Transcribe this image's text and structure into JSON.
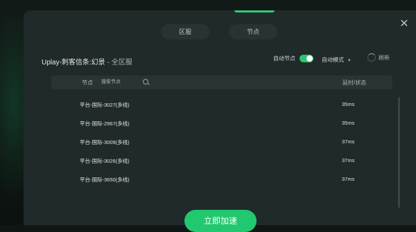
{
  "tabs": [
    {
      "label": "区服"
    },
    {
      "label": "节点"
    }
  ],
  "header": {
    "title": "Uplay-刺客信条:幻景",
    "subtitle": "- 全区服"
  },
  "controls": {
    "auto_node_label": "自动节点",
    "auto_node_on": true,
    "mode_label": "自动模式",
    "refresh_label": "刷新"
  },
  "table": {
    "col_node": "节点",
    "search_placeholder": "搜索节点",
    "col_latency": "延时/状态",
    "rows": [
      {
        "name": "平台-国际-3027(多线)",
        "latency": "35ms"
      },
      {
        "name": "平台-国际-2967(多线)",
        "latency": "35ms"
      },
      {
        "name": "平台-国际-3009(多线)",
        "latency": "37ms"
      },
      {
        "name": "平台-国际-3026(多线)",
        "latency": "37ms"
      },
      {
        "name": "平台-国际-3650(多线)",
        "latency": "37ms"
      }
    ]
  },
  "accelerate_label": "立即加速",
  "colors": {
    "accent": "#22c86f",
    "dialog_bg": "#202a2a"
  },
  "icons": [
    "close-icon",
    "search-icon",
    "refresh-icon",
    "chevron-down-icon"
  ]
}
